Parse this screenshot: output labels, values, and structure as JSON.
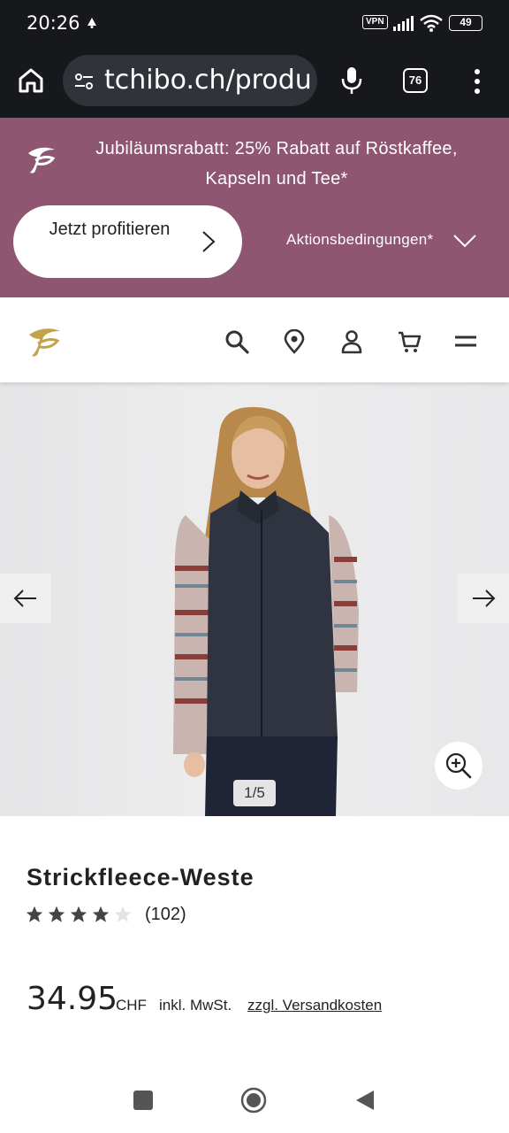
{
  "status_bar": {
    "time": "20:26",
    "vpn": "VPN",
    "battery": "49"
  },
  "browser": {
    "url": "tchibo.ch/produ",
    "tab_count": "76"
  },
  "promo": {
    "text": "Jubiläumsrabatt: 25% Rabatt auf Röstkaffee, Kapseln und Tee*",
    "cta_label": "Jetzt profitieren",
    "conditions_label": "Aktionsbedingungen*",
    "background": "#8e5671"
  },
  "header": {
    "icons": [
      "search-icon",
      "location-icon",
      "account-icon",
      "cart-icon",
      "menu-icon"
    ]
  },
  "gallery": {
    "counter": "1/5",
    "current": 1,
    "total": 5
  },
  "product": {
    "title": "Strickfleece-Weste",
    "rating": 4,
    "rating_max": 5,
    "review_count": "(102)",
    "price": "34.95",
    "currency": "CHF",
    "vat_note": "inkl. MwSt.",
    "shipping_link": "zzgl. Versandkosten"
  }
}
